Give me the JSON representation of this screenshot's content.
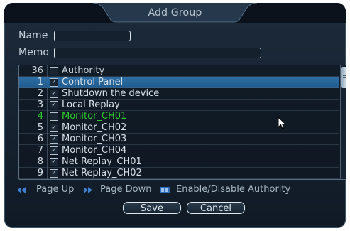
{
  "dialog": {
    "title": "Add Group"
  },
  "form": {
    "name_label": "Name",
    "name_value": "",
    "memo_label": "Memo",
    "memo_value": ""
  },
  "table": {
    "header": {
      "num": "36",
      "name": "Authority",
      "checked": false
    },
    "rows": [
      {
        "num": "1",
        "name": "Control Panel",
        "checked": true,
        "selected": true
      },
      {
        "num": "2",
        "name": "Shutdown the device",
        "checked": true
      },
      {
        "num": "3",
        "name": "Local Replay",
        "checked": true
      },
      {
        "num": "4",
        "name": "Monitor_CH01",
        "checked": false,
        "highlight": "green"
      },
      {
        "num": "5",
        "name": "Monitor_CH02",
        "checked": true
      },
      {
        "num": "6",
        "name": "Monitor_CH03",
        "checked": true
      },
      {
        "num": "7",
        "name": "Monitor_CH04",
        "checked": true
      },
      {
        "num": "8",
        "name": "Net Replay_CH01",
        "checked": true
      },
      {
        "num": "9",
        "name": "Net Replay_CH02",
        "checked": true
      }
    ]
  },
  "hints": {
    "page_up": "Page Up",
    "page_down": "Page Down",
    "toggle": "Enable/Disable Authority"
  },
  "buttons": {
    "save": "Save",
    "cancel": "Cancel"
  },
  "colors": {
    "accent": "#2e6fa6",
    "highlight_green": "#2fd12f",
    "background": "#142130"
  },
  "icons": {
    "page_up": "page-up-icon",
    "page_down": "page-down-icon",
    "toggle": "fn-key-icon",
    "pointer": "mouse-pointer-icon"
  }
}
